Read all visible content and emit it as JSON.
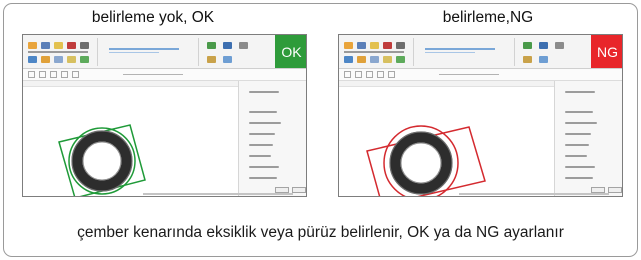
{
  "panels": [
    {
      "title": "belirleme yok, OK",
      "status": "OK",
      "status_color": "#2e9b3a",
      "marker_color": "#1f9a38",
      "marker_ring": "#1f9a38"
    },
    {
      "title": "belirleme,NG",
      "status": "NG",
      "status_color": "#e8262a",
      "marker_color": "#d42a2f",
      "marker_ring": "#d42a2f"
    }
  ],
  "caption": "çember kenarında eksiklik veya pürüz belirlenir, OK ya da NG ayarlanır"
}
